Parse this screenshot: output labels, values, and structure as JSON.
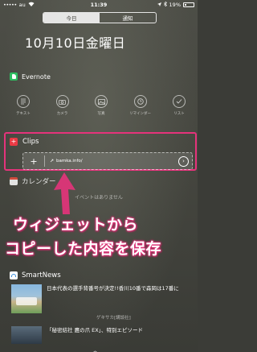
{
  "status_bar": {
    "signal_dots": "•••••",
    "carrier": "au",
    "time": "11:39",
    "battery": "19%"
  },
  "tabs": [
    {
      "label": "今日"
    },
    {
      "label": "通知"
    }
  ],
  "date": "10月10日金曜日",
  "evernote": {
    "title": "Evernote",
    "actions": [
      {
        "label": "テキスト"
      },
      {
        "label": "カメラ"
      },
      {
        "label": "写真"
      },
      {
        "label": "リマインダー"
      },
      {
        "label": "リスト"
      }
    ]
  },
  "clips": {
    "title": "Clips",
    "url": "bamka.info/"
  },
  "calendar": {
    "title": "カレンダー",
    "empty_text": "イベントはありません"
  },
  "overlay": {
    "line1": "ウィジェットから",
    "line2": "コピーした内容を保存"
  },
  "smartnews": {
    "title": "SmartNews",
    "items": [
      {
        "title": "日本代表の選手背番号が決定!!香川10番で森岡は17番に",
        "source": "ゲキサカ[講談社]"
      },
      {
        "title": "「秘密結社 鷹の爪 EX」、特別エピソード"
      }
    ]
  },
  "colors": {
    "highlight": "#e5337b",
    "evernote_green": "#2dbe60",
    "clips_red": "#ea3a44"
  }
}
